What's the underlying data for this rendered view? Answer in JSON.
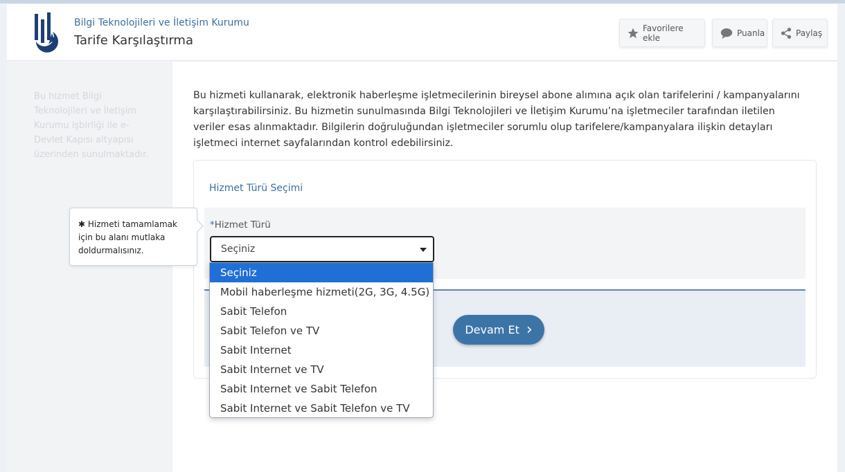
{
  "header": {
    "org_name": "Bilgi Teknolojileri ve İletişim Kurumu",
    "page_title": "Tarife Karşılaştırma",
    "actions": {
      "favorite": "Favorilere ekle",
      "rate": "Puanla",
      "share": "Paylaş"
    }
  },
  "sidebar": {
    "note": "Bu hizmet Bilgi Teknolojileri ve İletişim Kurumu işbirliği ile e-Devlet Kapısı altyapısı üzerinden sunulmaktadır."
  },
  "main": {
    "intro": "Bu hizmeti kullanarak, elektronik haberleşme işletmecilerinin bireysel abone alımına açık olan tarifelerini / kampanyalarını karşılaştırabilirsiniz. Bu hizmetin sunulmasında Bilgi Teknolojileri ve İletişim Kurumu’na işletmeciler tarafından iletilen veriler esas alınmaktadır. Bilgilerin doğruluğundan işletmeciler sorumlu olup tarifelere/kampanyalara ilişkin detayları işletmeci internet sayfalarından kontrol edebilirsiniz.",
    "section_title": "Hizmet Türü Seçimi",
    "field": {
      "required_mark": "*",
      "label": "Hizmet Türü",
      "selected": "Seçiniz"
    },
    "continue_label": "Devam Et",
    "continue_chevron": "›"
  },
  "tooltip": {
    "mark": "✱",
    "text": "Hizmeti tamamlamak için bu alanı mutlaka doldurmalısınız."
  },
  "dropdown": {
    "options": [
      "Seçiniz",
      "Mobil haberleşme hizmeti(2G, 3G, 4.5G)",
      "Sabit Telefon",
      "Sabit Telefon ve TV",
      "Sabit Internet",
      "Sabit Internet ve TV",
      "Sabit Internet ve Sabit Telefon",
      "Sabit Internet ve Sabit Telefon ve TV"
    ],
    "selected_index": 0
  },
  "colors": {
    "accent": "#3a6ea5",
    "button": "#3d74a8",
    "highlight": "#1f6fd6"
  },
  "icons": [
    "logo-icon",
    "star-icon",
    "speech-bubble-icon",
    "share-icon",
    "caret-down-icon",
    "chevron-right-icon"
  ]
}
